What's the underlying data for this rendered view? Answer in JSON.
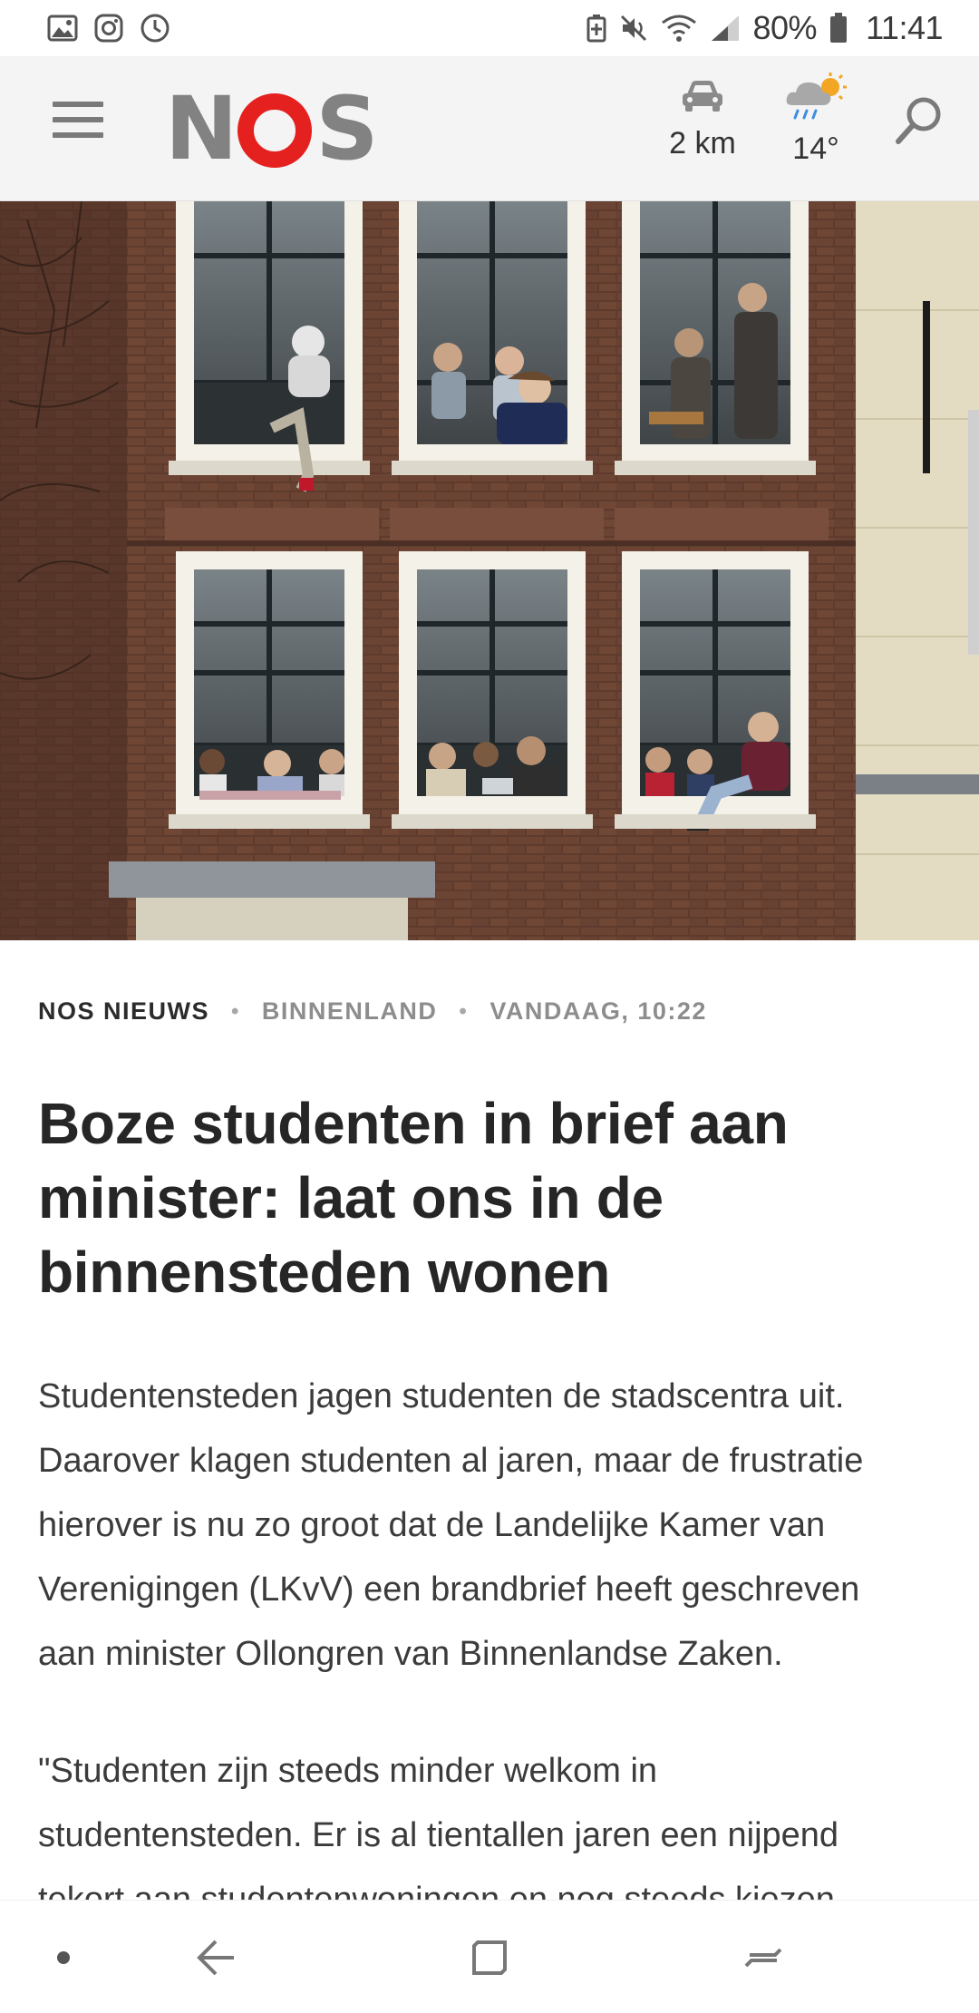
{
  "status_bar": {
    "battery": "80%",
    "time": "11:41",
    "left_icons": [
      "gallery-icon",
      "instagram-icon",
      "sync-icon"
    ],
    "right_icons": [
      "battery-saver-icon",
      "mute-icon",
      "wifi-icon",
      "signal-icon",
      "battery-icon"
    ]
  },
  "header": {
    "logo_text": "NOS",
    "traffic_label": "2 km",
    "traffic_icon": "car-icon",
    "weather_label": "14°",
    "weather_icon": "rain-sun-cloud-icon",
    "menu_icon": "hamburger-menu-icon",
    "search_icon": "search-icon",
    "logo_accent_color": "#e5211f"
  },
  "article": {
    "source": "NOS NIEUWS",
    "section": "BINNENLAND",
    "timestamp": "VANDAAG, 10:22",
    "headline_lines": [
      "Boze studenten in brief aan",
      "minister: laat ons in de",
      "binnensteden wonen"
    ],
    "p1_lines": [
      "Studentensteden jagen studenten de stadscentra uit.",
      "Daarover klagen studenten al jaren, maar de frustratie",
      "hierover is nu zo groot dat de Landelijke Kamer van",
      "Verenigingen (LKvV) een brandbrief heeft geschreven",
      "aan minister Ollongren van Binnenlandse Zaken."
    ],
    "p2_lines": [
      "\"Studenten zijn steeds minder welkom in",
      "studentensteden. Er is al tientallen jaren een nijpend",
      "tekort aan studentenwoningen en nog steeds kiezen"
    ]
  },
  "nav_bar": {
    "icons": [
      "dot-icon",
      "back-icon",
      "recents-icon",
      "switch-icon"
    ]
  }
}
